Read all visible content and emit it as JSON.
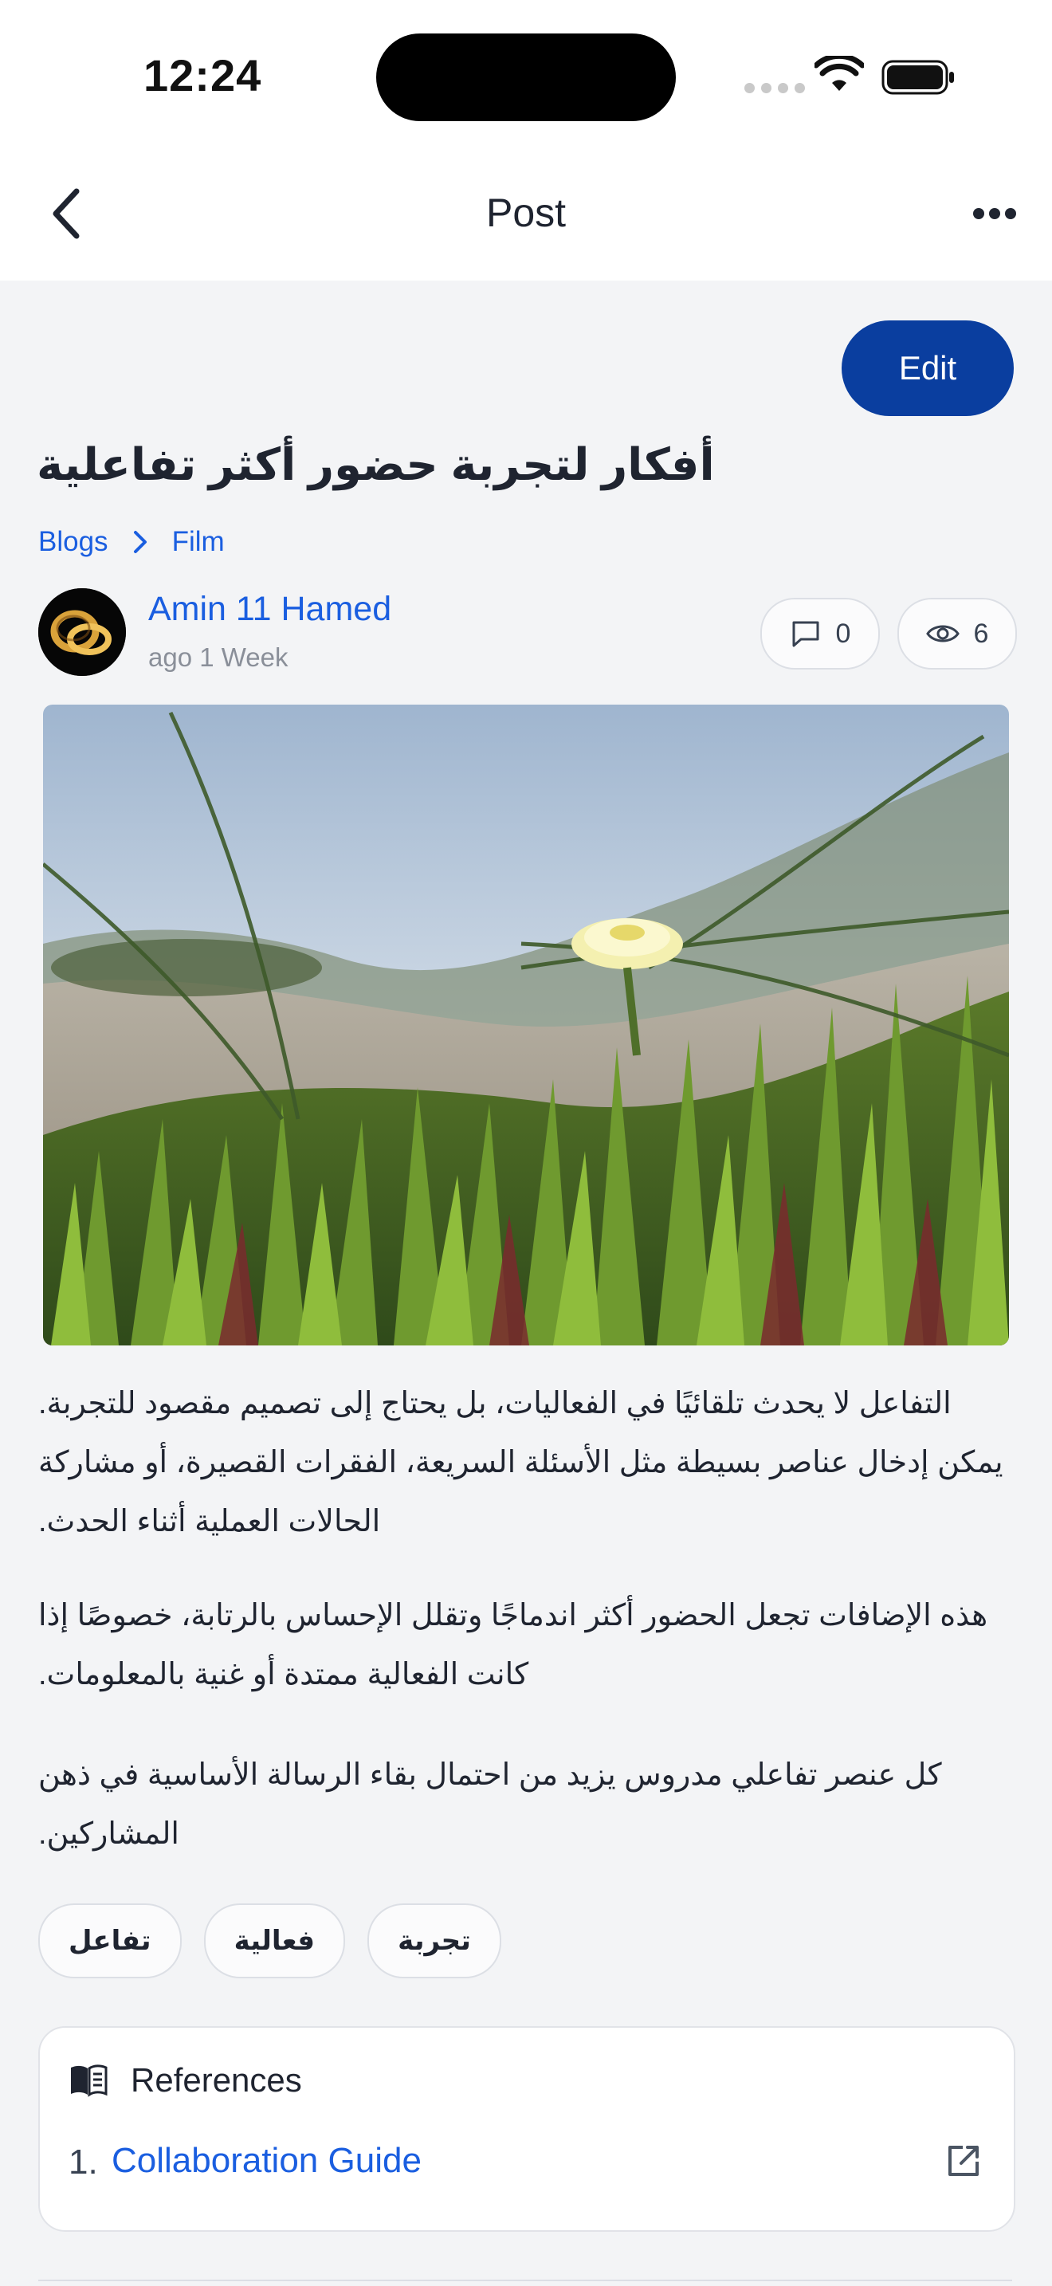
{
  "status_bar": {
    "time": "12:24"
  },
  "header": {
    "title": "Post",
    "back_icon": "chevron-left-icon",
    "more_icon": "more-dots-icon"
  },
  "actions": {
    "edit_label": "Edit"
  },
  "post": {
    "title": "أفكار لتجربة حضور أكثر تفاعلية",
    "breadcrumb": [
      "Blogs",
      "Film"
    ],
    "author": "Amin 11 Hamed",
    "time": "ago 1 Week",
    "comments": "0",
    "views": "6",
    "paragraphs": [
      "التفاعل لا يحدث تلقائيًا في الفعاليات، بل يحتاج إلى تصميم مقصود للتجربة. يمكن إدخال عناصر بسيطة مثل الأسئلة السريعة، الفقرات القصيرة، أو مشاركة الحالات العملية أثناء الحدث.",
      "هذه الإضافات تجعل الحضور أكثر اندماجًا وتقلل الإحساس بالرتابة، خصوصًا إذا كانت الفعالية ممتدة أو غنية بالمعلومات.",
      "كل عنصر تفاعلي مدروس يزيد من احتمال بقاء الرسالة الأساسية في ذهن المشاركين."
    ],
    "tags": [
      "تفاعل",
      "فعالية",
      "تجربة"
    ]
  },
  "references": {
    "title": "References",
    "items": [
      {
        "index": "1.",
        "label": "Collaboration Guide"
      }
    ]
  },
  "colors": {
    "accent": "#1a5ee0",
    "primary_button": "#0a3e9f",
    "background": "#f3f4f6"
  }
}
